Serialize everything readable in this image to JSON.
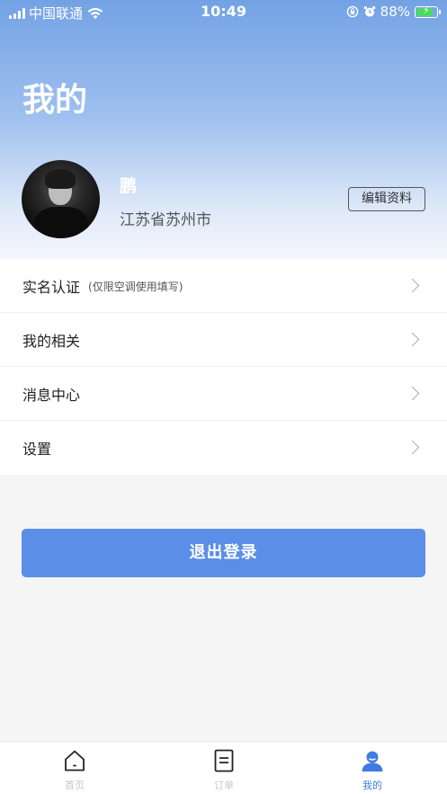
{
  "status_bar": {
    "carrier": "中国联通",
    "time": "10:49",
    "battery_percent": "88%",
    "battery_level": 0.88,
    "icons": [
      "signal-icon",
      "wifi-icon",
      "orientation-lock-icon",
      "alarm-icon",
      "battery-charging-icon"
    ]
  },
  "header": {
    "title": "我的"
  },
  "profile": {
    "name": "鹏",
    "location": "江苏省苏州市",
    "edit_label": "编辑资料"
  },
  "menu": {
    "items": [
      {
        "label": "实名认证",
        "sub": "(仅限空调使用填写)"
      },
      {
        "label": "我的相关",
        "sub": ""
      },
      {
        "label": "消息中心",
        "sub": ""
      },
      {
        "label": "设置",
        "sub": ""
      }
    ]
  },
  "logout_label": "退出登录",
  "tab_bar": {
    "tabs": [
      {
        "label": "首页",
        "icon": "home-icon",
        "active": false
      },
      {
        "label": "订单",
        "icon": "order-icon",
        "active": false
      },
      {
        "label": "我的",
        "icon": "profile-icon",
        "active": true
      }
    ]
  },
  "colors": {
    "accent": "#5b8ee6",
    "active_tab": "#3f7be0",
    "header_gradient_top": "#73a2e4",
    "inactive_tab": "#c8c8c8"
  }
}
